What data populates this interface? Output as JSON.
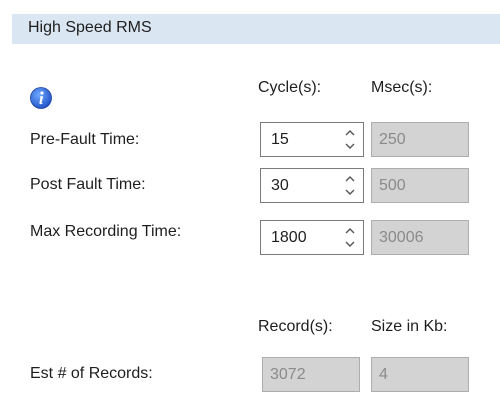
{
  "panel": {
    "title": "High Speed RMS"
  },
  "icons": {
    "info": "info-icon"
  },
  "columns": {
    "cycles": "Cycle(s):",
    "msec": "Msec(s):"
  },
  "rows": [
    {
      "label": "Pre-Fault Time:",
      "cycles": "15",
      "msec": "250"
    },
    {
      "label": "Post Fault Time:",
      "cycles": "30",
      "msec": "500"
    },
    {
      "label": "Max Recording Time:",
      "cycles": "1800",
      "msec": "30006"
    }
  ],
  "records": {
    "col_records": "Record(s):",
    "col_size": "Size in Kb:",
    "label": "Est # of Records:",
    "count": "3072",
    "size": "4"
  },
  "colors": {
    "header_bg": "#dbe6f3",
    "info_blue": "#1f5fd1",
    "readonly_bg": "#d3d3d3"
  }
}
